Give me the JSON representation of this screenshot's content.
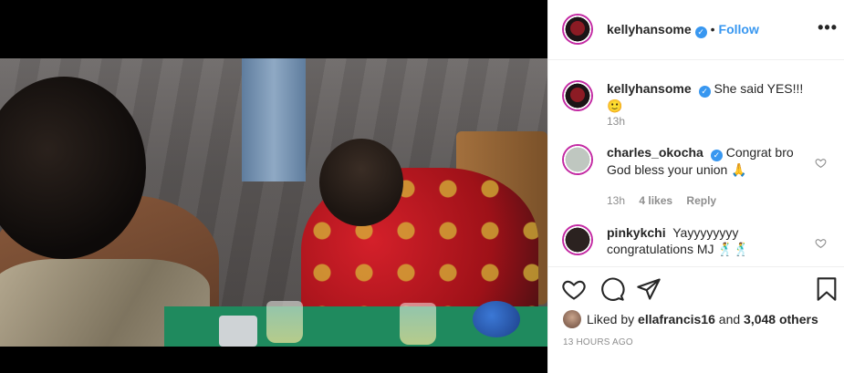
{
  "post": {
    "username": "kellyhansome",
    "follow_label": "Follow",
    "separator": "•",
    "more_label": "•••"
  },
  "comments": [
    {
      "username": "kellyhansome",
      "text": "She said YES!!! 🙂",
      "time": "13h"
    },
    {
      "username": "charles_okocha",
      "text": "Congrat bro God bless your union 🙏",
      "time": "13h",
      "likes": "4 likes",
      "reply": "Reply"
    },
    {
      "username": "pinkykchi",
      "text": "Yayyyyyyyy congratulations MJ 🕺🕺"
    }
  ],
  "likes": {
    "prefix": "Liked by",
    "user": "ellafrancis16",
    "joiner": "and",
    "others": "3,048 others"
  },
  "timestamp": "13 HOURS AGO",
  "colors": {
    "accent": "#3897f0",
    "text": "#262626",
    "muted": "#8e8e8e"
  },
  "icons": [
    "verified-icon",
    "more-icon",
    "heart-icon",
    "comment-icon",
    "share-icon",
    "bookmark-icon"
  ]
}
